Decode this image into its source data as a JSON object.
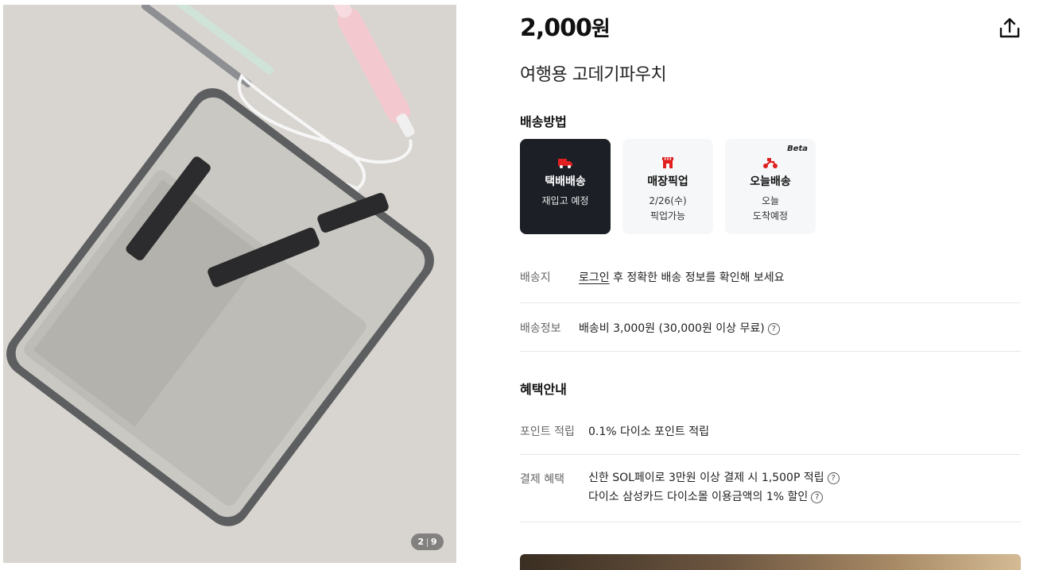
{
  "gallery": {
    "current": "2",
    "total": "9",
    "image_subject": "travel curling iron pouch product photo"
  },
  "product": {
    "price": "2,000",
    "currency": "원",
    "title": "여행용 고데기파우치"
  },
  "shipping": {
    "section_title": "배송방법",
    "options": [
      {
        "name": "택배배송",
        "sub1": "재입고 예정",
        "sub2": "",
        "icon": "delivery-truck-icon",
        "active": true
      },
      {
        "name": "매장픽업",
        "sub1": "2/26(수)",
        "sub2": "픽업가능",
        "icon": "store-icon",
        "active": false
      },
      {
        "name": "오늘배송",
        "sub1": "오늘",
        "sub2": "도착예정",
        "icon": "scooter-icon",
        "badge": "Beta",
        "active": false
      }
    ],
    "destination_label": "배송지",
    "destination_link": "로그인",
    "destination_text": " 후 정확한 배송 정보를 확인해 보세요",
    "info_label": "배송정보",
    "info_text": "배송비 3,000원 (30,000원 이상 무료)"
  },
  "benefits": {
    "section_title": "혜택안내",
    "points_label": "포인트 적립",
    "points_text": "0.1% 다이소 포인트 적립",
    "payment_label": "결제 혜택",
    "payment_lines": [
      "신한 SOL페이로 3만원 이상 결제 시 1,500P 적립",
      "다이소 삼성카드 다이소몰 이용금액의 1% 할인"
    ]
  },
  "colors": {
    "active_option_bg": "#1c1f26",
    "option_bg": "#f6f7f9",
    "icon_red": "#e02020"
  }
}
